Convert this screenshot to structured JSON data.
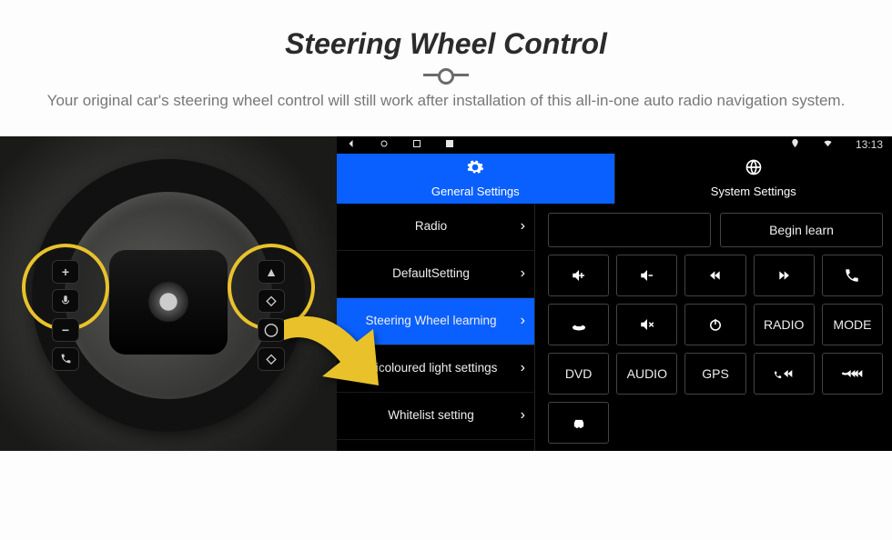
{
  "hero": {
    "title": "Steering Wheel Control",
    "subtitle": "Your original car's steering wheel control will still work after installation of this all-in-one auto radio navigation system."
  },
  "status": {
    "time": "13:13"
  },
  "tabs": {
    "general": "General Settings",
    "system": "System Settings"
  },
  "sidebar": {
    "items": [
      "Radio",
      "DefaultSetting",
      "Steering Wheel learning",
      "Tricoloured light settings",
      "Whitelist setting"
    ],
    "active_index": 2
  },
  "panel": {
    "begin_learn": "Begin learn",
    "buttons": {
      "radio": "RADIO",
      "mode": "MODE",
      "dvd": "DVD",
      "audio": "AUDIO",
      "gps": "GPS"
    }
  }
}
